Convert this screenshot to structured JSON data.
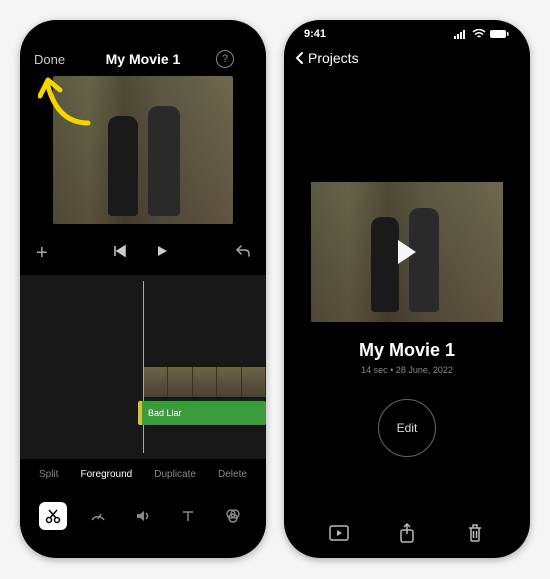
{
  "left": {
    "done": "Done",
    "title": "My Movie 1",
    "help_icon": "?",
    "add": "+",
    "audio_label": "Bad Liar",
    "actions": {
      "split": "Split",
      "foreground": "Foreground",
      "duplicate": "Duplicate",
      "delete": "Delete"
    }
  },
  "right": {
    "time": "9:41",
    "back": "Projects",
    "title": "My Movie 1",
    "meta": "14 sec • 28 June, 2022",
    "edit": "Edit"
  }
}
